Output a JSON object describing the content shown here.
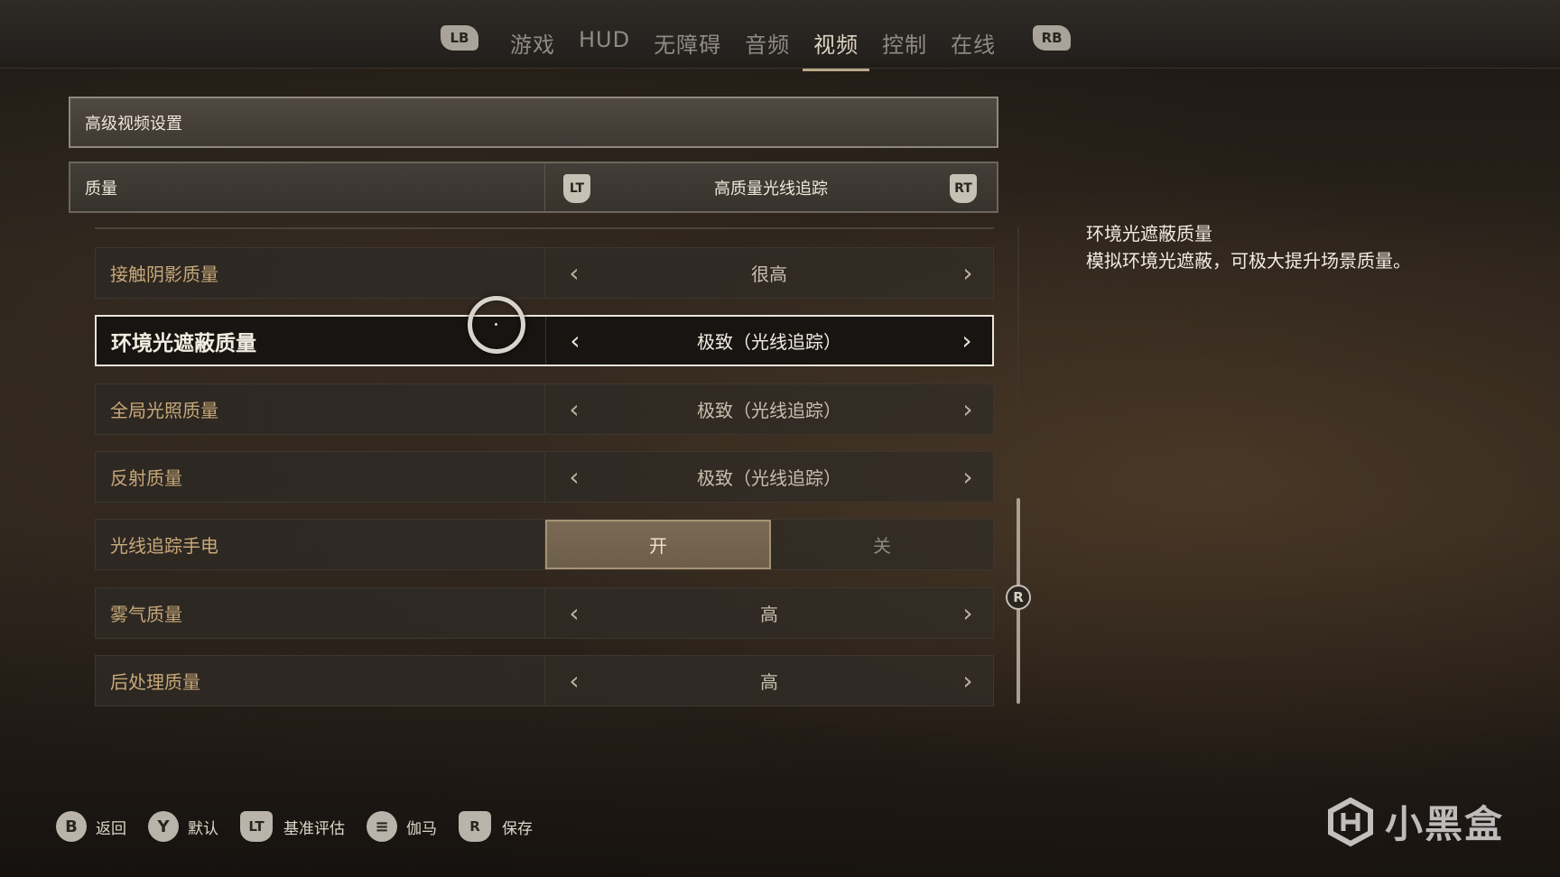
{
  "tabs": {
    "lb": "LB",
    "rb": "RB",
    "items": [
      {
        "label": "游戏"
      },
      {
        "label": "HUD"
      },
      {
        "label": "无障碍"
      },
      {
        "label": "音频"
      },
      {
        "label": "视频",
        "active": true
      },
      {
        "label": "控制"
      },
      {
        "label": "在线"
      }
    ]
  },
  "section": {
    "title": "高级视频设置"
  },
  "quality": {
    "label": "质量",
    "value": "高质量光线追踪",
    "lt": "LT",
    "rt": "RT"
  },
  "rows": [
    {
      "label": "接触阴影质量",
      "value": "很高"
    },
    {
      "label": "环境光遮蔽质量",
      "value": "极致（光线追踪）",
      "selected": true
    },
    {
      "label": "全局光照质量",
      "value": "极致（光线追踪）"
    },
    {
      "label": "反射质量",
      "value": "极致（光线追踪）"
    },
    {
      "label": "光线追踪手电",
      "on": "开",
      "off": "关"
    },
    {
      "label": "雾气质量",
      "value": "高"
    },
    {
      "label": "后处理质量",
      "value": "高"
    }
  ],
  "scroll": {
    "badge": "R"
  },
  "description": {
    "title": "环境光遮蔽质量",
    "text": "模拟环境光遮蔽，可极大提升场景质量。"
  },
  "footer": [
    {
      "key": "B",
      "label": "返回"
    },
    {
      "key": "Y",
      "label": "默认"
    },
    {
      "key": "LT",
      "label": "基准评估"
    },
    {
      "key": "≡",
      "label": "伽马"
    },
    {
      "key": "R",
      "label": "保存"
    }
  ],
  "watermark": {
    "text": "小黑盒"
  }
}
